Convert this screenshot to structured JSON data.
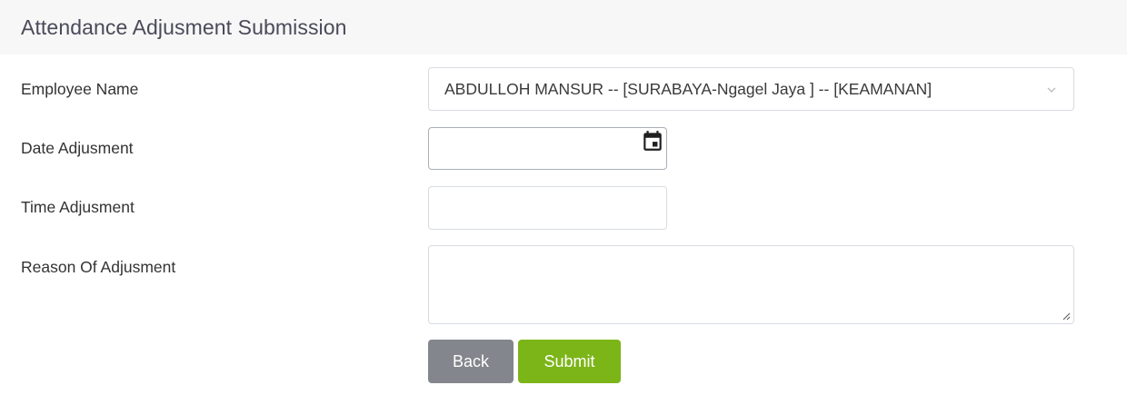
{
  "header": {
    "title": "Attendance Adjusment Submission"
  },
  "form": {
    "employee_label": "Employee Name",
    "employee_value": "ABDULLOH MANSUR -- [SURABAYA-Ngagel Jaya ] -- [KEAMANAN]",
    "date_label": "Date Adjusment",
    "date_value": "",
    "time_label": "Time Adjusment",
    "time_value": "",
    "reason_label": "Reason Of Adjusment",
    "reason_value": ""
  },
  "buttons": {
    "back_label": "Back",
    "submit_label": "Submit"
  },
  "icons": {
    "dropdown": "chevron-down-icon",
    "date": "calendar-icon",
    "resize": "resize-handle-icon"
  },
  "colors": {
    "back_button": "#83868c",
    "submit_button": "#7cb518",
    "header_bg": "#f7f7f7"
  }
}
